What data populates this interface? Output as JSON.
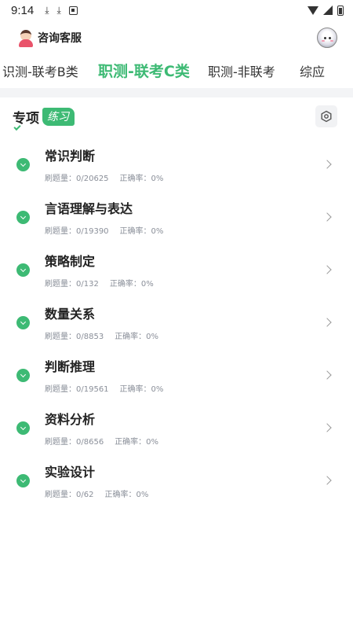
{
  "status_bar": {
    "time": "9:14",
    "icons": [
      "download-icon",
      "download-icon",
      "system-app-icon"
    ],
    "right_icons": [
      "wifi-icon",
      "signal-icon",
      "battery-icon"
    ]
  },
  "header": {
    "title": "咨询客服"
  },
  "tabs": [
    {
      "label": "识测-联考B类",
      "active": false
    },
    {
      "label": "职测-联考C类",
      "active": true
    },
    {
      "label": "职测-非联考",
      "active": false
    },
    {
      "label": "综应",
      "active": false
    }
  ],
  "section": {
    "title": "专项",
    "tag": "练习"
  },
  "colors": {
    "accent": "#3dba74",
    "text": "#222222",
    "muted": "#8a8f99",
    "band": "#f3f4f6"
  },
  "items": [
    {
      "name": "常识判断",
      "count_label": "刷题量：0/20625",
      "accuracy_label": "正确率：0%"
    },
    {
      "name": "言语理解与表达",
      "count_label": "刷题量：0/19390",
      "accuracy_label": "正确率：0%"
    },
    {
      "name": "策略制定",
      "count_label": "刷题量：0/132",
      "accuracy_label": "正确率：0%"
    },
    {
      "name": "数量关系",
      "count_label": "刷题量：0/8853",
      "accuracy_label": "正确率：0%"
    },
    {
      "name": "判断推理",
      "count_label": "刷题量：0/19561",
      "accuracy_label": "正确率：0%"
    },
    {
      "name": "资料分析",
      "count_label": "刷题量：0/8656",
      "accuracy_label": "正确率：0%"
    },
    {
      "name": "实验设计",
      "count_label": "刷题量：0/62",
      "accuracy_label": "正确率：0%"
    }
  ]
}
